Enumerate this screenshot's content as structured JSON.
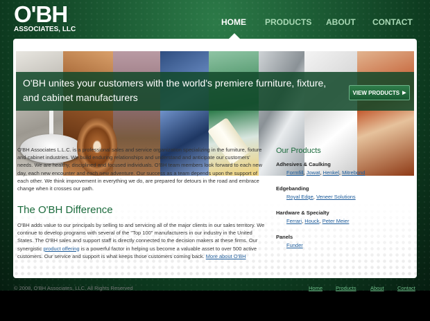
{
  "logo": {
    "main": "O'BH",
    "sub": "ASSOCIATES, LLC"
  },
  "nav": [
    {
      "label": "HOME"
    },
    {
      "label": "PRODUCTS"
    },
    {
      "label": "ABOUT"
    },
    {
      "label": "CONTACT"
    }
  ],
  "banner": {
    "heading": "O'BH unites your customers with the world's premiere furniture, fixture, and cabinet manufacturers",
    "button": "VIEW PRODUCTS",
    "button_icon": "arrow-right-icon"
  },
  "intro": "O'BH Associates L.L.C. is a professional sales and service organization specializing in the furniture, fixture and cabinet industries.  We build enduring relationships and understand and anticipate our customers' needs.  We are healthy, disciplined and focused individuals.  O'BH team members look forward to each new day, each new encounter and each new adventure.  Our success as a team depends upon the support of each other.  We think improvement in everything we do, are prepared for detours in the road and embrace change when it crosses our path.",
  "difference": {
    "title": "The O'BH Difference",
    "p_before_link": "O'BH adds value to our principals by selling to and servicing all of the major clients in our sales territory. We continue to develop programs with several of the \"Top 100\" manufacturers in our industry in the United States. The O'BH sales and support staff is directly connected to the decision makers at these firms. Our synergistic ",
    "link1": "product offering",
    "p_after_link": " is a powerful factor in helping us become a valuable asset to over 500 active customers. Our service and support is what keeps those customers coming back. ",
    "link2": "More about O'BH"
  },
  "sidebar": {
    "title": "Our Products",
    "categories": [
      {
        "title": "Adhesives & Caulking",
        "links": [
          "Formfill",
          "Jowat",
          "Henkel",
          "Mitrebond"
        ]
      },
      {
        "title": "Edgebanding",
        "links": [
          "Royal Edge",
          "Veneer Solutions"
        ]
      },
      {
        "title": "Hardware & Specialty",
        "links": [
          "Ferrari",
          "Houck",
          "Peter Meier"
        ]
      },
      {
        "title": "Panels",
        "links": [
          "Funder"
        ]
      }
    ]
  },
  "footer": {
    "copyright": "© 2008, O'BH Associates, LLC. All Rights Reserved",
    "links": [
      "Home",
      "Products",
      "About",
      "Contact"
    ]
  },
  "colors": {
    "brand_green": "#1a6a3b",
    "link_blue": "#1a5a9a",
    "footer_link": "#6fbf8a"
  }
}
